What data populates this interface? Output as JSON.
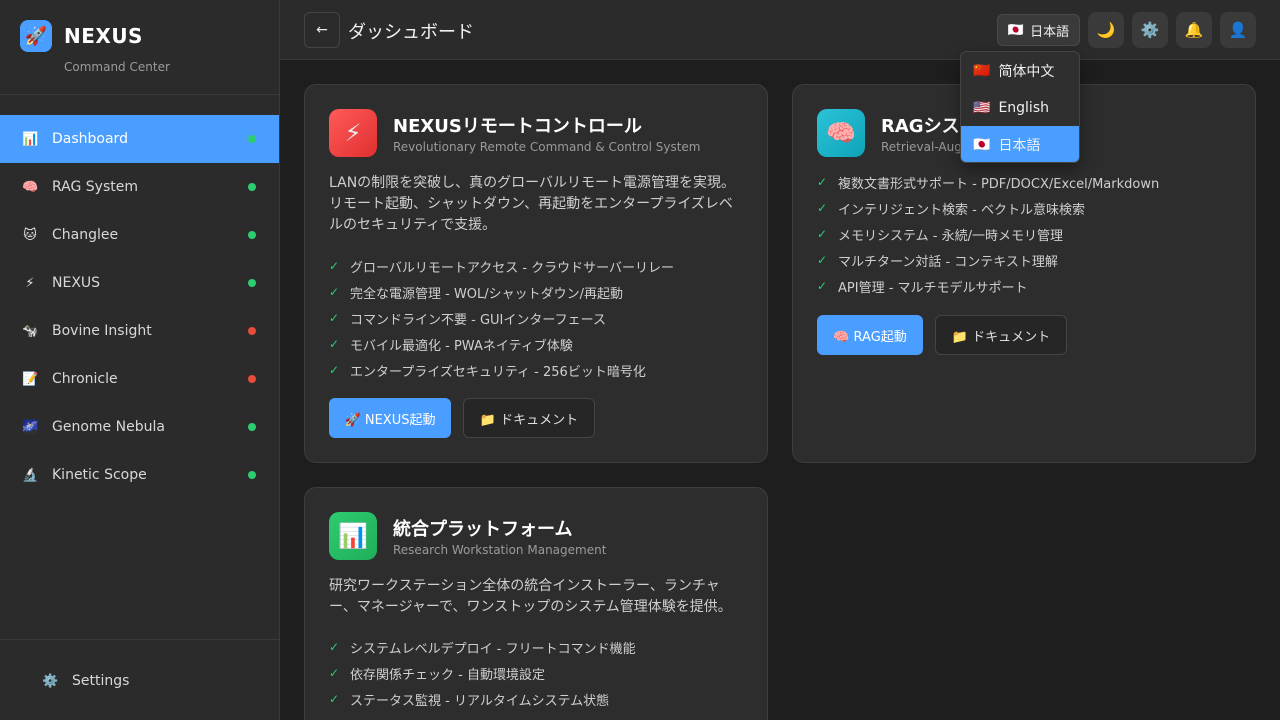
{
  "brand": {
    "name": "NEXUS",
    "subtitle": "Command Center",
    "logo_icon": "🚀"
  },
  "sidebar": {
    "items": [
      {
        "label": "Dashboard",
        "icon": "📊",
        "status": "green",
        "active": true
      },
      {
        "label": "RAG System",
        "icon": "🧠",
        "status": "green"
      },
      {
        "label": "Changlee",
        "icon": "🐱",
        "status": "green"
      },
      {
        "label": "NEXUS",
        "icon": "⚡",
        "status": "green"
      },
      {
        "label": "Bovine Insight",
        "icon": "🐄",
        "status": "red"
      },
      {
        "label": "Chronicle",
        "icon": "📝",
        "status": "red"
      },
      {
        "label": "Genome Nebula",
        "icon": "🌌",
        "status": "green"
      },
      {
        "label": "Kinetic Scope",
        "icon": "🔬",
        "status": "green"
      }
    ],
    "settings_label": "Settings",
    "settings_icon": "⚙️"
  },
  "header": {
    "back_icon": "←",
    "title": "ダッシュボード",
    "language_label": "日本語",
    "language_flag": "🇯🇵",
    "theme_icon": "🌙",
    "settings_icon": "⚙️",
    "bell_icon": "🔔",
    "user_icon": "👤"
  },
  "language_menu": [
    {
      "flag": "🇨🇳",
      "label": "简体中文"
    },
    {
      "flag": "🇺🇸",
      "label": "English"
    },
    {
      "flag": "🇯🇵",
      "label": "日本語",
      "selected": true
    }
  ],
  "cards": {
    "nexus": {
      "icon": "⚡",
      "title": "NEXUSリモートコントロール",
      "subtitle": "Revolutionary Remote Command & Control System",
      "desc": "LANの制限を突破し、真のグローバルリモート電源管理を実現。リモート起動、シャットダウン、再起動をエンタープライズレベルのセキュリティで支援。",
      "features": [
        "グローバルリモートアクセス - クラウドサーバーリレー",
        "完全な電源管理 - WOL/シャットダウン/再起動",
        "コマンドライン不要 - GUIインターフェース",
        "モバイル最適化 - PWAネイティブ体験",
        "エンタープライズセキュリティ - 256ビット暗号化"
      ],
      "primary_btn": "🚀 NEXUS起動",
      "secondary_btn": "📁 ドキュメント"
    },
    "rag": {
      "icon": "🧠",
      "title": "RAGシス",
      "subtitle": "Retrieval-Augm",
      "features": [
        "複数文書形式サポート - PDF/DOCX/Excel/Markdown",
        "インテリジェント検索 - ベクトル意味検索",
        "メモリシステム - 永続/一時メモリ管理",
        "マルチターン対話 - コンテキスト理解",
        "API管理 - マルチモデルサポート"
      ],
      "primary_btn": "🧠 RAG起動",
      "secondary_btn": "📁 ドキュメント"
    },
    "platform": {
      "icon": "📊",
      "title": "統合プラットフォーム",
      "subtitle": "Research Workstation Management",
      "desc": "研究ワークステーション全体の統合インストーラー、ランチャー、マネージャーで、ワンストップのシステム管理体験を提供。",
      "features": [
        "システムレベルデプロイ - フリートコマンド機能",
        "依存関係チェック - 自動環境設定",
        "ステータス監視 - リアルタイムシステム状態"
      ]
    }
  },
  "colors": {
    "accent": "#4a9eff",
    "status_green": "#2ecc71",
    "status_red": "#e74c3c"
  }
}
